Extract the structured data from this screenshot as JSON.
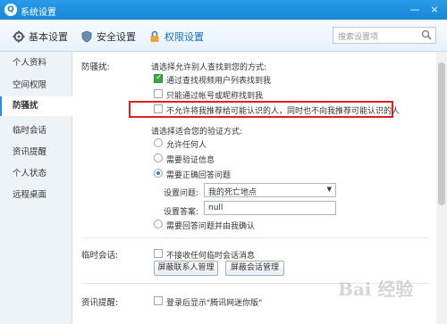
{
  "window": {
    "title": "系统设置",
    "minimize_label": "—",
    "close_label": "×"
  },
  "tabs": [
    {
      "label": "基本设置",
      "icon": "gear-icon"
    },
    {
      "label": "安全设置",
      "icon": "shield-icon"
    },
    {
      "label": "权限设置",
      "icon": "lock-icon"
    }
  ],
  "search": {
    "placeholder": "搜索设置项"
  },
  "sidebar": {
    "items": [
      {
        "label": "个人资料"
      },
      {
        "label": "空间权限"
      },
      {
        "label": "防骚扰"
      },
      {
        "label": "临时会话"
      },
      {
        "label": "资讯提醒"
      },
      {
        "label": "个人状态"
      },
      {
        "label": "远程桌面"
      }
    ],
    "active_index": 2
  },
  "anti_harass": {
    "section_label": "防骚扰:",
    "find_prompt": "请选择允许别人查找到您的方式:",
    "find_options": [
      {
        "label": "通过查找视频用户列表找到我",
        "checked": true
      },
      {
        "label": "只能通过帐号或昵称找到我",
        "checked": false
      },
      {
        "label": "不允许将我推荐给可能认识的人，同时也不向我推荐可能认识的人",
        "checked": false
      }
    ],
    "verify_prompt": "请选择适合您的验证方式:",
    "verify_options": [
      {
        "label": "允许任何人",
        "checked": false
      },
      {
        "label": "需要验证信息",
        "checked": false
      },
      {
        "label": "需要正确回答问题",
        "checked": true
      },
      {
        "label": "需要回答问题并由我确认",
        "checked": false
      }
    ],
    "question_label": "设置问题:",
    "question_value": "我的死亡地点",
    "answer_label": "设置答案:",
    "answer_value": "null"
  },
  "temp_session": {
    "section_label": "临时会话:",
    "option": "不接收任何临时会话消息",
    "btn_contacts": "屏蔽联系人管理",
    "btn_sessions": "屏蔽会话管理"
  },
  "news": {
    "section_label": "资讯提醒:",
    "option": "登录后显示\"腾讯网迷你版\""
  },
  "watermark": "Bai 经验"
}
